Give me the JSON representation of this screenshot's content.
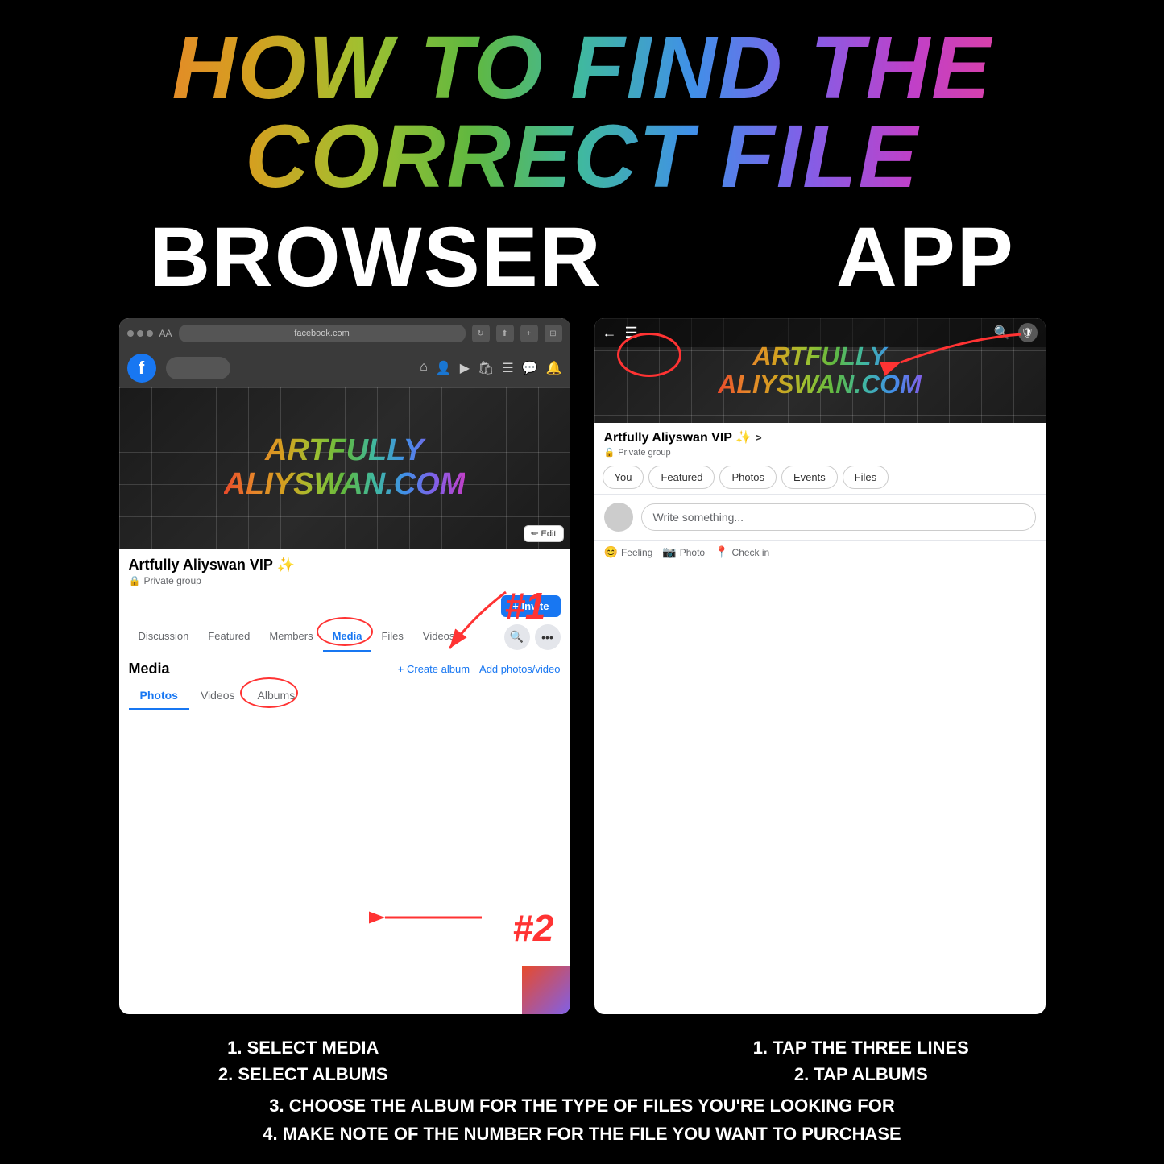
{
  "page": {
    "title": "How To Find The Correct File",
    "background": "#000000"
  },
  "header": {
    "title_line1": "HOW TO FIND THE CORRECT FILE"
  },
  "sections": {
    "browser_label": "BROWSER",
    "app_label": "APP"
  },
  "browser": {
    "url": "facebook.com",
    "group_name": "Artfully Aliyswan VIP ✨",
    "group_private": "Private group",
    "nav_tabs": [
      "Discussion",
      "Featured",
      "Members",
      "Media",
      "Files",
      "Videos"
    ],
    "active_tab": "Media",
    "media_title": "Media",
    "create_album_link": "+ Create album",
    "add_photos_link": "Add photos/video",
    "sub_tabs": [
      "Photos",
      "Videos",
      "Albums"
    ],
    "active_sub_tab": "Photos",
    "invite_label": "+ Invite",
    "edit_label": "✏ Edit",
    "annotation_1": "#1",
    "annotation_2": "#2",
    "cover_title_line1": "ARTFULLY",
    "cover_title_line2": "ALIYSWAN.COM"
  },
  "app": {
    "group_name": "Artfully Aliyswan VIP ✨",
    "group_name_arrow": ">",
    "group_private": "Private group",
    "tabs": [
      "You",
      "Featured",
      "Photos",
      "Events",
      "Files"
    ],
    "active_tab": "You",
    "write_placeholder": "Write something...",
    "actions": [
      {
        "icon": "😊",
        "label": "Feeling"
      },
      {
        "icon": "📷",
        "label": "Photo"
      },
      {
        "icon": "📍",
        "label": "Check in"
      }
    ],
    "cover_title_line1": "ARTFULLY",
    "cover_title_line2": "ALIYSWAN.COM"
  },
  "instructions": {
    "browser_line1": "1. SELECT MEDIA",
    "browser_line2": "2. SELECT ALBUMS",
    "app_line1": "1. TAP THE THREE LINES",
    "app_line2": "2. TAP ALBUMS",
    "shared_line3": "3. CHOOSE THE ALBUM FOR THE TYPE OF FILES YOU'RE LOOKING FOR",
    "shared_line4": "4. MAKE NOTE OF THE NUMBER FOR THE FILE YOU WANT TO PURCHASE"
  }
}
